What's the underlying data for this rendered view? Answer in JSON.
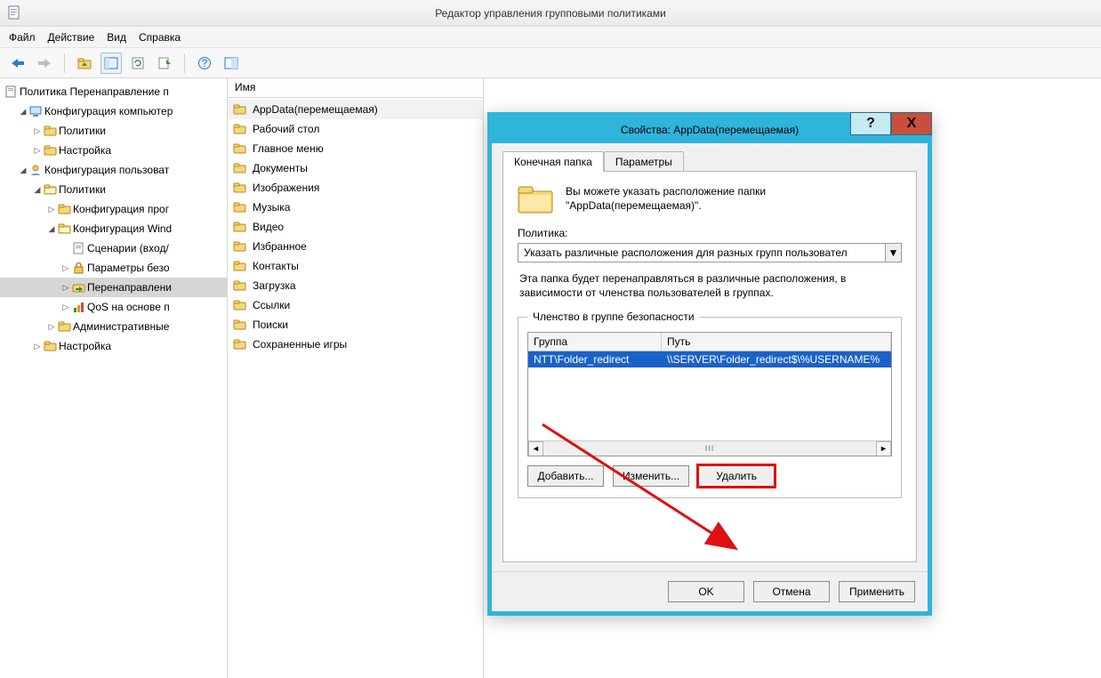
{
  "window": {
    "title": "Редактор управления групповыми политиками"
  },
  "menubar": [
    "Файл",
    "Действие",
    "Вид",
    "Справка"
  ],
  "tree": {
    "root": "Политика Перенаправление п",
    "nodes": [
      {
        "lvl": 1,
        "exp": "▿",
        "icon": "computer",
        "label": "Конфигурация компьютер",
        "sel": false
      },
      {
        "lvl": 2,
        "exp": "▹",
        "icon": "folder",
        "label": "Политики",
        "sel": false
      },
      {
        "lvl": 2,
        "exp": "▹",
        "icon": "folder",
        "label": "Настройка",
        "sel": false
      },
      {
        "lvl": 1,
        "exp": "▿",
        "icon": "user",
        "label": "Конфигурация пользоват",
        "sel": false
      },
      {
        "lvl": 2,
        "exp": "▿",
        "icon": "folder-open",
        "label": "Политики",
        "sel": false
      },
      {
        "lvl": 3,
        "exp": "▹",
        "icon": "folder",
        "label": "Конфигурация прог",
        "sel": false
      },
      {
        "lvl": 3,
        "exp": "▿",
        "icon": "folder-open",
        "label": "Конфигурация Wind",
        "sel": false
      },
      {
        "lvl": 4,
        "exp": "",
        "icon": "script",
        "label": "Сценарии (вход/",
        "sel": false
      },
      {
        "lvl": 4,
        "exp": "▹",
        "icon": "lock",
        "label": "Параметры безо",
        "sel": false
      },
      {
        "lvl": 4,
        "exp": "▹",
        "icon": "folder-redirect",
        "label": "Перенаправлени",
        "sel": true
      },
      {
        "lvl": 4,
        "exp": "▹",
        "icon": "qos",
        "label": "QoS на основе п",
        "sel": false
      },
      {
        "lvl": 3,
        "exp": "▹",
        "icon": "folder",
        "label": "Административные",
        "sel": false
      },
      {
        "lvl": 2,
        "exp": "▹",
        "icon": "folder",
        "label": "Настройка",
        "sel": false
      }
    ]
  },
  "list": {
    "header": "Имя",
    "items": [
      "AppData(перемещаемая)",
      "Рабочий стол",
      "Главное меню",
      "Документы",
      "Изображения",
      "Музыка",
      "Видео",
      "Избранное",
      "Контакты",
      "Загрузка",
      "Ссылки",
      "Поиски",
      "Сохраненные игры"
    ],
    "selected_index": 0
  },
  "dialog": {
    "title": "Свойства: AppData(перемещаемая)",
    "help_label": "?",
    "close_label": "X",
    "tabs": {
      "active": "Конечная папка",
      "inactive": "Параметры"
    },
    "intro": "Вы можете указать расположение папки \"AppData(перемещаемая)\".",
    "policy_label": "Политика:",
    "policy_value": "Указать различные расположения для разных групп пользовател",
    "description": "Эта папка будет перенаправляться в различные расположения, в зависимости от членства пользователей в группах.",
    "group_legend": "Членство в группе безопасности",
    "group_headers": {
      "c1": "Группа",
      "c2": "Путь"
    },
    "group_row": {
      "c1": "NTT\\Folder_redirect",
      "c2": "\\\\SERVER\\Folder_redirect$\\%USERNAME%"
    },
    "buttons": {
      "add": "Добавить...",
      "edit": "Изменить...",
      "del": "Удалить"
    },
    "footer": {
      "ok": "OK",
      "cancel": "Отмена",
      "apply": "Применить"
    }
  }
}
